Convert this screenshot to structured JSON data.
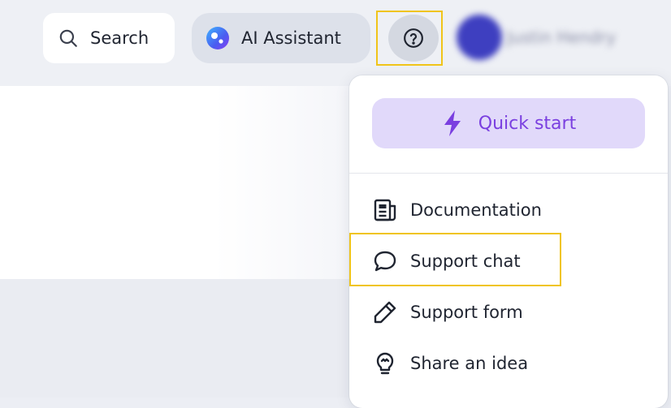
{
  "header": {
    "search_label": "Search",
    "ai_assistant_label": "AI Assistant",
    "username": "Justin Hendry"
  },
  "help_menu": {
    "quick_start_label": "Quick start",
    "items": [
      {
        "label": "Documentation",
        "icon": "book-icon"
      },
      {
        "label": "Support chat",
        "icon": "chat-bubble-icon"
      },
      {
        "label": "Support form",
        "icon": "pencil-icon"
      },
      {
        "label": "Share an idea",
        "icon": "lightbulb-icon"
      }
    ]
  },
  "colors": {
    "accent_purple": "#7a3fe0",
    "quick_start_bg": "#e1d9fa",
    "highlight": "#f0c419"
  }
}
